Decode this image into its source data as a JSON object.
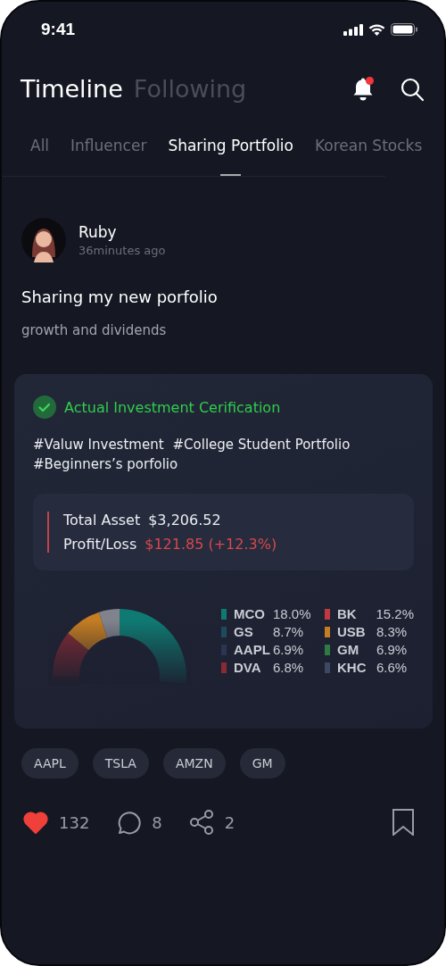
{
  "status_bar": {
    "time": "9:41"
  },
  "header": {
    "tabs": [
      {
        "label": "Timeline",
        "selected": true
      },
      {
        "label": "Following",
        "selected": false
      }
    ],
    "has_notification": true
  },
  "categories": [
    {
      "label": "All",
      "selected": false
    },
    {
      "label": "Influencer",
      "selected": false
    },
    {
      "label": "Sharing Portfolio",
      "selected": true
    },
    {
      "label": "Korean Stocks",
      "selected": false
    }
  ],
  "post": {
    "author": "Ruby",
    "time": "36minutes ago",
    "title": "Sharing my new porfolio",
    "subtitle": "growth and dividends",
    "portfolio": {
      "verified": true,
      "certification": "Actual Investment Cerification",
      "hashtags": [
        "#Valuw Investment",
        "#College Student Portfolio",
        "#Beginners’s porfolio"
      ],
      "summary": [
        {
          "label": "Total Asset",
          "value": "$3,206.52",
          "kind": "neutral"
        },
        {
          "label": "Profit/Loss",
          "value": "$121.85 (+12.3%)",
          "kind": "loss"
        }
      ],
      "legend": [
        {
          "ticker": "MCO",
          "share": "18.0%",
          "color": "#0f7a72"
        },
        {
          "ticker": "BK",
          "share": "15.2%",
          "color": "#c0393f"
        },
        {
          "ticker": "GS",
          "share": "8.7%",
          "color": "#1f4a5c"
        },
        {
          "ticker": "USB",
          "share": "8.3%",
          "color": "#c47d22"
        },
        {
          "ticker": "AAPL",
          "share": "6.9%",
          "color": "#2a3552"
        },
        {
          "ticker": "GM",
          "share": "6.9%",
          "color": "#2e7a45"
        },
        {
          "ticker": "DVA",
          "share": "6.8%",
          "color": "#8a2a35"
        },
        {
          "ticker": "KHC",
          "share": "6.6%",
          "color": "#3d4863"
        }
      ]
    },
    "tickers": [
      "AAPL",
      "TSLA",
      "AMZN",
      "GM"
    ],
    "likes": "132",
    "liked": true,
    "comments": "8",
    "shares": "2",
    "bookmarked": false
  }
}
